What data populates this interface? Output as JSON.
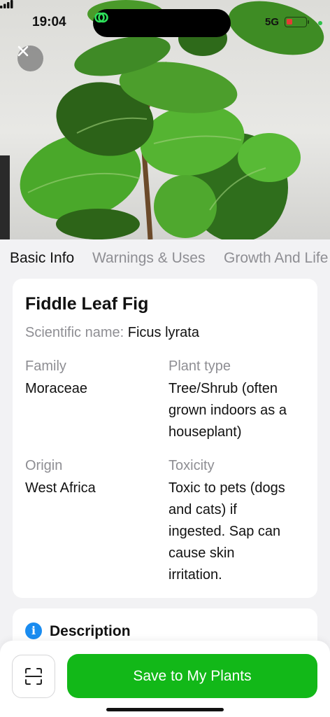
{
  "status_bar": {
    "time": "19:04",
    "network": "5G",
    "battery_level": 0.2,
    "colors": {
      "battery_low": "#e53935",
      "indicator_dot": "#2ec24a",
      "island_icon": "#2ee05a"
    }
  },
  "hero": {
    "close_icon": "close-icon"
  },
  "tabs": [
    {
      "label": "Basic Info",
      "active": true
    },
    {
      "label": "Warnings & Uses",
      "active": false
    },
    {
      "label": "Growth And Life",
      "active": false
    }
  ],
  "plant": {
    "name": "Fiddle Leaf Fig",
    "scientific_label": "Scientific name:",
    "scientific_name": "Ficus lyrata",
    "family_label": "Family",
    "family": "Moraceae",
    "plant_type_label": "Plant type",
    "plant_type_lines": [
      "Tree/Shrub (often",
      "grown indoors as a",
      "houseplant)"
    ],
    "origin_label": "Origin",
    "origin": "West Africa",
    "toxicity_label": "Toxicity",
    "toxicity_lines": [
      "Toxic to pets (dogs",
      "and cats) if",
      "ingested. Sap can",
      "cause skin",
      "irritation."
    ]
  },
  "description": {
    "icon": "info-icon",
    "title": "Description"
  },
  "bottom_bar": {
    "scan_icon": "scan-icon",
    "save_label": "Save to My Plants",
    "colors": {
      "save_button": "#12b818"
    }
  }
}
